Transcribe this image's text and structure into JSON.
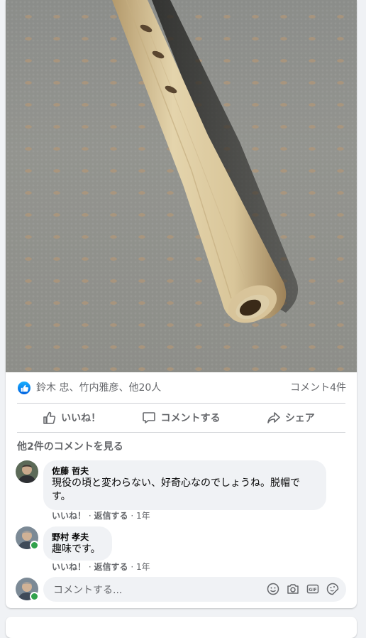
{
  "post": {
    "photo_alt": "",
    "reactions": {
      "icon": "like-icon",
      "text": "鈴木 忠、竹内雅彦、他20人",
      "comment_count": "コメント4件"
    },
    "actions": [
      {
        "label": "いいね！",
        "icon": "thumbs-up-icon"
      },
      {
        "label": "コメントする",
        "icon": "comment-icon"
      },
      {
        "label": "シェア",
        "icon": "share-icon"
      }
    ],
    "more_comments": "他2件のコメントを見る",
    "comments": [
      {
        "author": "佐藤 哲夫",
        "text_line1": "現役の頃と変わらない、好奇心なのでしょうね。脱帽で",
        "text_line2": "す。",
        "like": "いいね！",
        "reply": "返信する",
        "time": "1年"
      },
      {
        "author": "野村 孝夫",
        "text_line1": "趣味です。",
        "like": "いいね！",
        "reply": "返信する",
        "time": "1年"
      }
    ],
    "composer": {
      "placeholder": "コメントする...",
      "icons": [
        "emoji-icon",
        "camera-icon",
        "gif-icon",
        "sticker-icon"
      ]
    }
  },
  "colors": {
    "secondary_text": "#65676b",
    "bubble": "#f0f2f5",
    "like_blue": "#1877f2",
    "online": "#31a24c"
  }
}
